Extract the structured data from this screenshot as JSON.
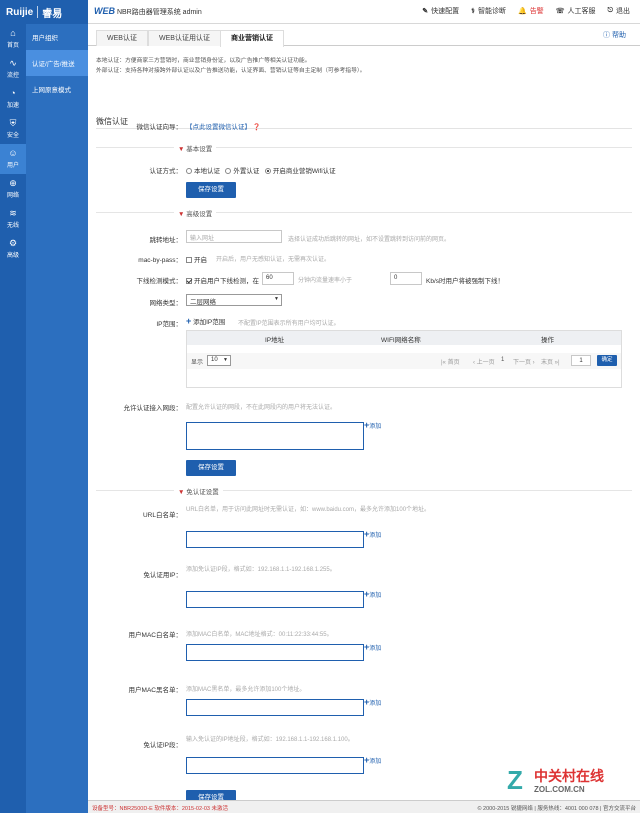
{
  "brand": {
    "logo": "Ruijie",
    "logo2": "睿易",
    "title_prefix": "WEB",
    "title": "NBR路由器管理系统 admin"
  },
  "toplinks": [
    {
      "label": "快速配置",
      "icon": "wand-icon"
    },
    {
      "label": "智能诊断",
      "icon": "stethoscope-icon"
    },
    {
      "label": "告警",
      "icon": "bell-icon"
    },
    {
      "label": "人工客服",
      "icon": "headset-icon"
    },
    {
      "label": "退出",
      "icon": "logout-icon"
    }
  ],
  "sidebar": [
    {
      "label": "首页",
      "icon": "home-icon"
    },
    {
      "label": "流控",
      "icon": "chart-icon"
    },
    {
      "label": "加速",
      "icon": "speedometer-icon"
    },
    {
      "label": "安全",
      "icon": "shield-icon"
    },
    {
      "label": "用户",
      "icon": "user-icon"
    },
    {
      "label": "网络",
      "icon": "globe-icon"
    },
    {
      "label": "无线",
      "icon": "wifi-icon"
    },
    {
      "label": "高级",
      "icon": "gear-icon"
    }
  ],
  "subnav": [
    {
      "label": "用户组织"
    },
    {
      "label": "认证/广告/推送"
    },
    {
      "label": "上网原意模式"
    }
  ],
  "tabs": [
    {
      "label": "WEB认证"
    },
    {
      "label": "WEB认证用认证"
    },
    {
      "label": "商业营销认证"
    }
  ],
  "help": "帮助",
  "notes": [
    "本地认证：方便商家三方营销时，商业营销身份证，以及广告推广等相关认证功能。",
    "外部认证：支持各种对接跨外部认证以及广告推送功能，认证界面、营销认证等自主定制（可参考指导）。"
  ],
  "section_title": "微信认证",
  "wechat": {
    "label": "微信认证向导：",
    "link": "【点此设置微信认证】"
  },
  "basic": {
    "title": "基本设置",
    "auth_label": "认证方式：",
    "options": [
      "本地认证",
      "外置认证",
      "开启商业营销Wifi认证"
    ],
    "selected": 2,
    "save": "保存设置"
  },
  "advanced": {
    "title": "高级设置",
    "portal_label": "跳转地址：",
    "portal_placeholder": "输入网址",
    "portal_hint": "选择认证成功后跳转的网址，如不设置跳转到访问前的网页。",
    "mac_label": "mac-by-pass：",
    "mac_value": "开启",
    "mac_hint": "开启后，用户无感知认证，无需再次认证。",
    "offline_label": "下线检测模式：",
    "offline_text": "开启用户下线检测，在",
    "offline_val1": "60",
    "offline_mid": "分钟内流量速率小于",
    "offline_val2": "0",
    "offline_end": "Kb/s时用户将被强制下线！",
    "nettype_label": "网络类型：",
    "nettype_value": "二层网络",
    "ip_label": "IP范围：",
    "ip_add": "添加IP范围",
    "ip_hint": "不配置IP范围表示所有用户均可认证。",
    "table_headers": [
      "IP地址",
      "WIFI网络名称",
      "操作"
    ],
    "show_label": "显示",
    "show_value": "10",
    "pager": [
      "|« 首页",
      "‹ 上一页",
      "1",
      "下一页 ›",
      "末页 »|",
      "1",
      "确定"
    ],
    "allow_label": "允许认证接入网段：",
    "allow_hint": "配置允许认证的网段，不在此网段内的用户将无法认证。",
    "save": "保存设置"
  },
  "whitelist": {
    "title": "免认证设置",
    "url_label": "URL白名单：",
    "url_hint": "URL白名单，用于访问此网址时无需认证，如：www.baidu.com，最多允许添加100个地址。",
    "ip_label": "免认证用IP：",
    "ip_hint": "添加免认证IP段，格式如：192.168.1.1-192.168.1.255。",
    "mac_white_label": "用户MAC白名单：",
    "mac_white_hint": "添加MAC白名单，MAC地址格式：00:11:22:33:44:55。",
    "mac_black_label": "用户MAC黑名单：",
    "mac_black_hint": "添加MAC黑名单，最多允许添加100个地址。",
    "free_label": "免认证IP段：",
    "free_hint": "输入免认证的IP地址段，格式如：192.168.1.1-192.168.1.100。",
    "add": "添加",
    "save": "保存设置"
  },
  "footer": {
    "left": "设备型号：NBR2500D-E  软件版本：2015-02-03 未激活",
    "right": "© 2000-2015 锐捷网络  |  服务热线：4001 000 078  |  官方交流平台"
  },
  "watermark": {
    "cn": "中关村在线",
    "en": "ZOL.COM.CN"
  }
}
